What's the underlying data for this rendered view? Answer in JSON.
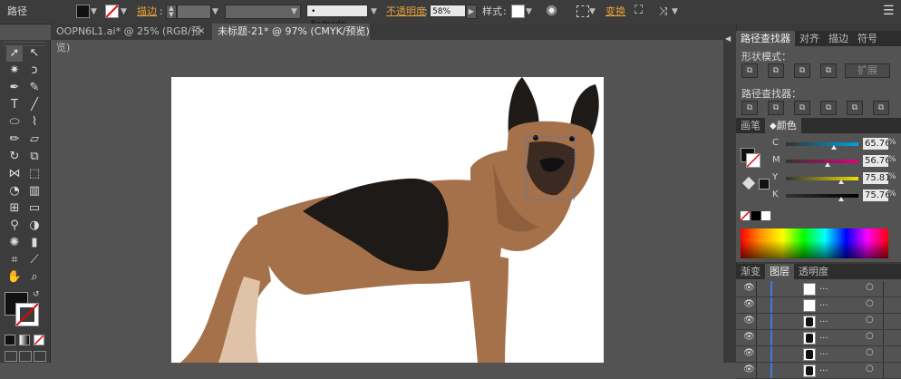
{
  "toolbar": {
    "path_label": "路径",
    "stroke_label": "描边",
    "stroke_value": "",
    "brush_value": "Redondo...",
    "opacity_label": "不透明度",
    "opacity_value": "58%",
    "style_label": "样式",
    "transform_label": "变换"
  },
  "tabs": [
    {
      "label": "OOPN6L1.ai* @ 25% (RGB/预览)",
      "close": "×"
    },
    {
      "label": "未标题-21* @ 97% (CMYK/预览)",
      "close": "×"
    }
  ],
  "pathfinder": {
    "tabs": [
      "路径查找器",
      "对齐",
      "描边",
      "符号"
    ],
    "shape_modes_label": "形状模式：",
    "expand_label": "扩展",
    "pathfinders_label": "路径查找器："
  },
  "color": {
    "tabs": [
      "画笔",
      "颜色"
    ],
    "channels": [
      {
        "label": "C",
        "value": "65.76",
        "unit": "%",
        "level": 0.66,
        "color": "#00a0e0"
      },
      {
        "label": "M",
        "value": "56.76",
        "unit": "%",
        "level": 0.57,
        "color": "#e0007a"
      },
      {
        "label": "Y",
        "value": "75.81",
        "unit": "%",
        "level": 0.76,
        "color": "#f0e000"
      },
      {
        "label": "K",
        "value": "75.76",
        "unit": "%",
        "level": 0.76,
        "color": "#000000"
      }
    ]
  },
  "layers": {
    "tabs": [
      "渐变",
      "图层",
      "透明度"
    ],
    "rows": [
      "...",
      "...",
      "...",
      "...",
      "...",
      "..."
    ]
  },
  "colors": {
    "dog_brown": "#a5714a",
    "dog_dark": "#1e1a18",
    "dog_light": "#dfc2a8",
    "dog_shade": "#8f5f3d",
    "accent": "#e8a13a",
    "layer_blue": "#3d7ad9"
  }
}
